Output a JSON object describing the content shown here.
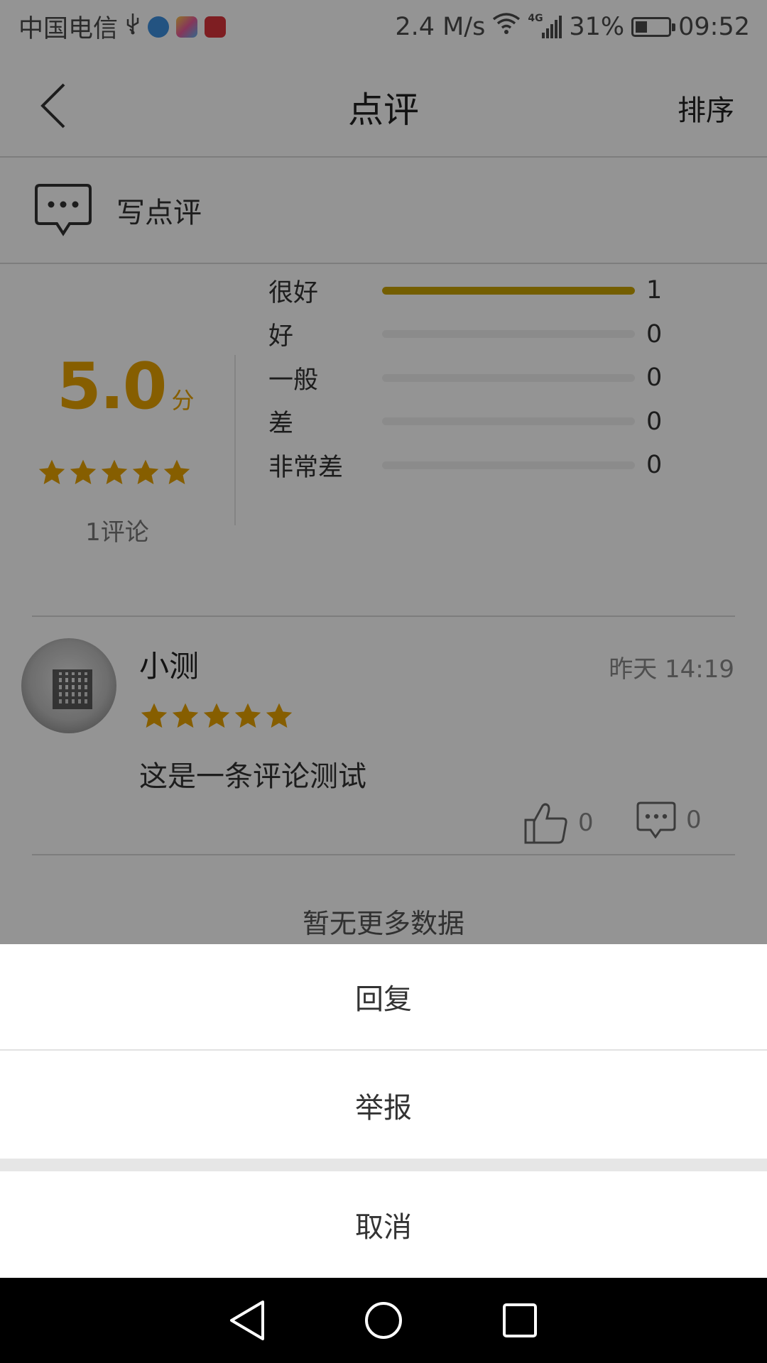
{
  "status_bar": {
    "carrier": "中国电信",
    "network_speed": "2.4 M/s",
    "network_type": "4G",
    "battery": "31%",
    "battery_level": 0.31,
    "time": "09:52",
    "icons": [
      "usb-icon",
      "app-notification-icon",
      "gallery-icon",
      "huawei-icon",
      "wifi-icon",
      "signal-icon",
      "battery-icon"
    ]
  },
  "header": {
    "title": "点评",
    "sort_label": "排序"
  },
  "write_review": {
    "label": "写点评"
  },
  "rating_summary": {
    "score": "5.0",
    "score_unit": "分",
    "stars": 5,
    "review_count": "1评论",
    "distribution": [
      {
        "label": "很好",
        "count": "1",
        "fraction": 1.0
      },
      {
        "label": "好",
        "count": "0",
        "fraction": 0
      },
      {
        "label": "一般",
        "count": "0",
        "fraction": 0
      },
      {
        "label": "差",
        "count": "0",
        "fraction": 0
      },
      {
        "label": "非常差",
        "count": "0",
        "fraction": 0
      }
    ]
  },
  "review": {
    "author": "小测",
    "time": "昨天 14:19",
    "stars": 5,
    "text": "这是一条评论测试",
    "likes": "0",
    "comments": "0"
  },
  "list_footer": "暂无更多数据",
  "action_sheet": {
    "reply_label": "回复",
    "report_label": "举报",
    "cancel_label": "取消"
  },
  "colors": {
    "accent": "#E7A200",
    "bar_fill": "#C9A200",
    "overlay": "rgba(0,0,0,0.42)"
  }
}
